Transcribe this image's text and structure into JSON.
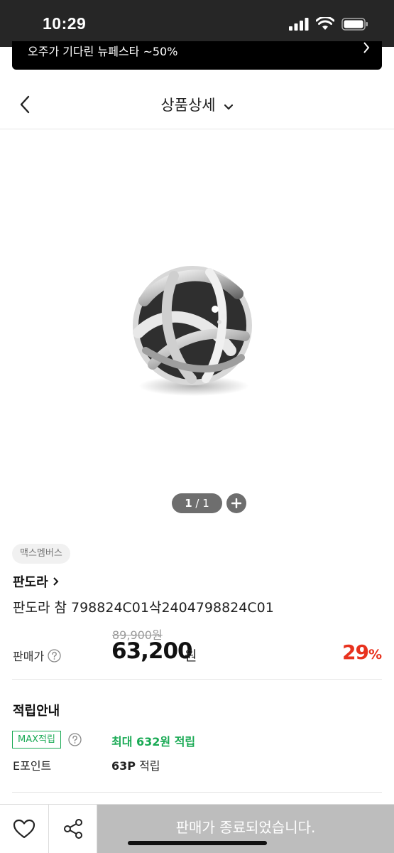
{
  "status_bar": {
    "time": "10:29"
  },
  "promo": {
    "text": "오주가 기다린 뉴페스타 ~50%"
  },
  "header": {
    "title": "상품상세"
  },
  "gallery": {
    "current": "1",
    "separator": "/",
    "total": "1"
  },
  "product": {
    "badge": "맥스멤버스",
    "brand": "판도라",
    "name": "판도라 참 798824C01삭2404798824C01",
    "original_price": "89,900원",
    "price_label": "판매가",
    "sale_price": "63,200",
    "currency": "원",
    "discount_number": "29",
    "discount_unit": "%"
  },
  "points": {
    "title": "적립안내",
    "max_badge": "MAX적립",
    "max_text": "최대 632원 적립",
    "epoint_label": "E포인트",
    "epoint_amount": "63P",
    "epoint_suffix": " 적립"
  },
  "bottom_bar": {
    "like_icon": "heart-icon",
    "share_icon": "share-icon",
    "sold_out_label": "판매가 종료되었습니다."
  },
  "colors": {
    "accent_green": "#1aaa55",
    "discount_red": "#e8321e",
    "disabled_gray": "#bdbdbd"
  }
}
